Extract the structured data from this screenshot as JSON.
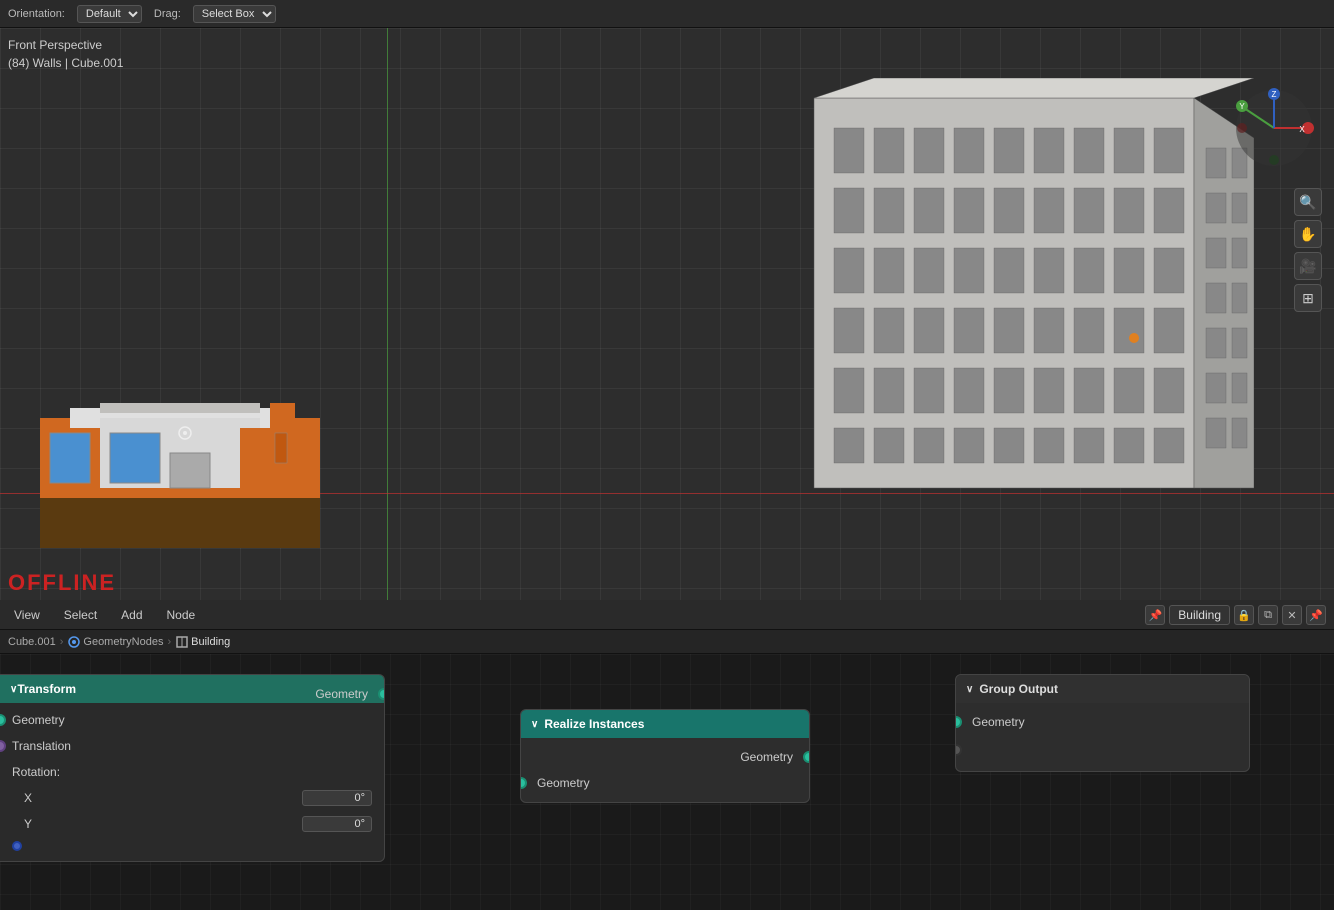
{
  "topbar": {
    "orientation_label": "Orientation:",
    "orientation_value": "Default",
    "drag_label": "Drag:",
    "drag_value": "Select Box"
  },
  "viewport": {
    "view_label": "Front Perspective",
    "object_label": "(84) Walls | Cube.001"
  },
  "offline_text": "OFFLINE",
  "node_editor": {
    "menu_items": [
      "View",
      "Select",
      "Add",
      "Node"
    ],
    "node_name": "Building",
    "breadcrumb": [
      "Cube.001",
      "GeometryNodes",
      "Building"
    ],
    "nodes": {
      "left_panel": {
        "header": "Transform",
        "rows": [
          {
            "label": "Geometry",
            "socket_type": "teal",
            "side": "left"
          },
          {
            "label": "Translation",
            "socket_type": "purple",
            "side": "left"
          },
          {
            "label": "Rotation:",
            "type": "label"
          },
          {
            "label": "X",
            "value": "0°"
          },
          {
            "label": "Y",
            "value": "0°"
          }
        ],
        "geometry_output_label": "Geometry"
      },
      "realize_instances": {
        "header": "Realize Instances",
        "input_label": "Geometry",
        "output_label": "Geometry"
      },
      "group_output": {
        "header": "Group Output",
        "geometry_label": "Geometry"
      }
    }
  },
  "icons": {
    "chevron_down": "∨",
    "search": "🔍",
    "move": "✋",
    "camera": "📷",
    "grid": "⊞",
    "lock": "🔒",
    "copy": "⧉",
    "close": "✕",
    "pin": "📌"
  },
  "colors": {
    "teal_socket": "#2abf9e",
    "purple_socket": "#8060a0",
    "teal_header": "#18756b",
    "connection_line": "#2abf9e",
    "grid_line": "rgba(255,255,255,0.05)"
  }
}
